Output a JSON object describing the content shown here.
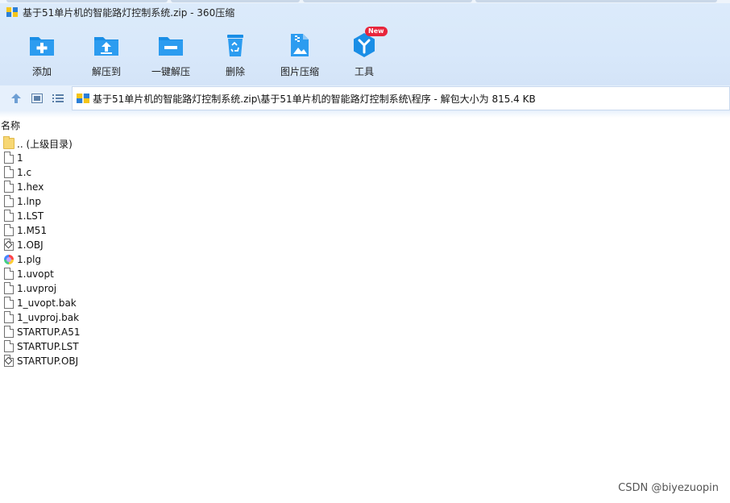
{
  "window": {
    "title": "基于51单片机的智能路灯控制系统.zip - 360压缩",
    "app_icon": "zip-archive-icon"
  },
  "toolbar": {
    "items": [
      {
        "label": "添加",
        "icon": "add-folder-icon"
      },
      {
        "label": "解压到",
        "icon": "extract-to-icon"
      },
      {
        "label": "一键解压",
        "icon": "one-click-extract-icon"
      },
      {
        "label": "删除",
        "icon": "recycle-bin-icon"
      },
      {
        "label": "图片压缩",
        "icon": "image-compress-icon"
      },
      {
        "label": "工具",
        "icon": "tools-icon",
        "badge": "New"
      }
    ]
  },
  "address_bar": {
    "path": "基于51单片机的智能路灯控制系统.zip\\基于51单片机的智能路灯控制系统\\程序 - 解包大小为 815.4 KB",
    "nav_icons": [
      "up-arrow-icon",
      "thumbnail-view-icon",
      "list-view-icon"
    ]
  },
  "file_list": {
    "column_header": "名称",
    "files": [
      {
        "name": ".. (上级目录)",
        "icon": "folder-icon"
      },
      {
        "name": "1",
        "icon": "file-icon"
      },
      {
        "name": "1.c",
        "icon": "file-icon"
      },
      {
        "name": "1.hex",
        "icon": "file-icon"
      },
      {
        "name": "1.lnp",
        "icon": "file-icon"
      },
      {
        "name": "1.LST",
        "icon": "file-icon"
      },
      {
        "name": "1.M51",
        "icon": "file-icon"
      },
      {
        "name": "1.OBJ",
        "icon": "object-file-icon"
      },
      {
        "name": "1.plg",
        "icon": "plg-file-icon"
      },
      {
        "name": "1.uvopt",
        "icon": "file-icon"
      },
      {
        "name": "1.uvproj",
        "icon": "file-icon"
      },
      {
        "name": "1_uvopt.bak",
        "icon": "file-icon"
      },
      {
        "name": "1_uvproj.bak",
        "icon": "file-icon"
      },
      {
        "name": "STARTUP.A51",
        "icon": "file-icon"
      },
      {
        "name": "STARTUP.LST",
        "icon": "file-icon"
      },
      {
        "name": "STARTUP.OBJ",
        "icon": "object-file-icon"
      }
    ]
  },
  "watermark": "CSDN @biyezuopin",
  "colors": {
    "toolbar_bg": "#d8e8fa",
    "icon_blue": "#1a8ee6",
    "badge_red": "#e8253b"
  }
}
